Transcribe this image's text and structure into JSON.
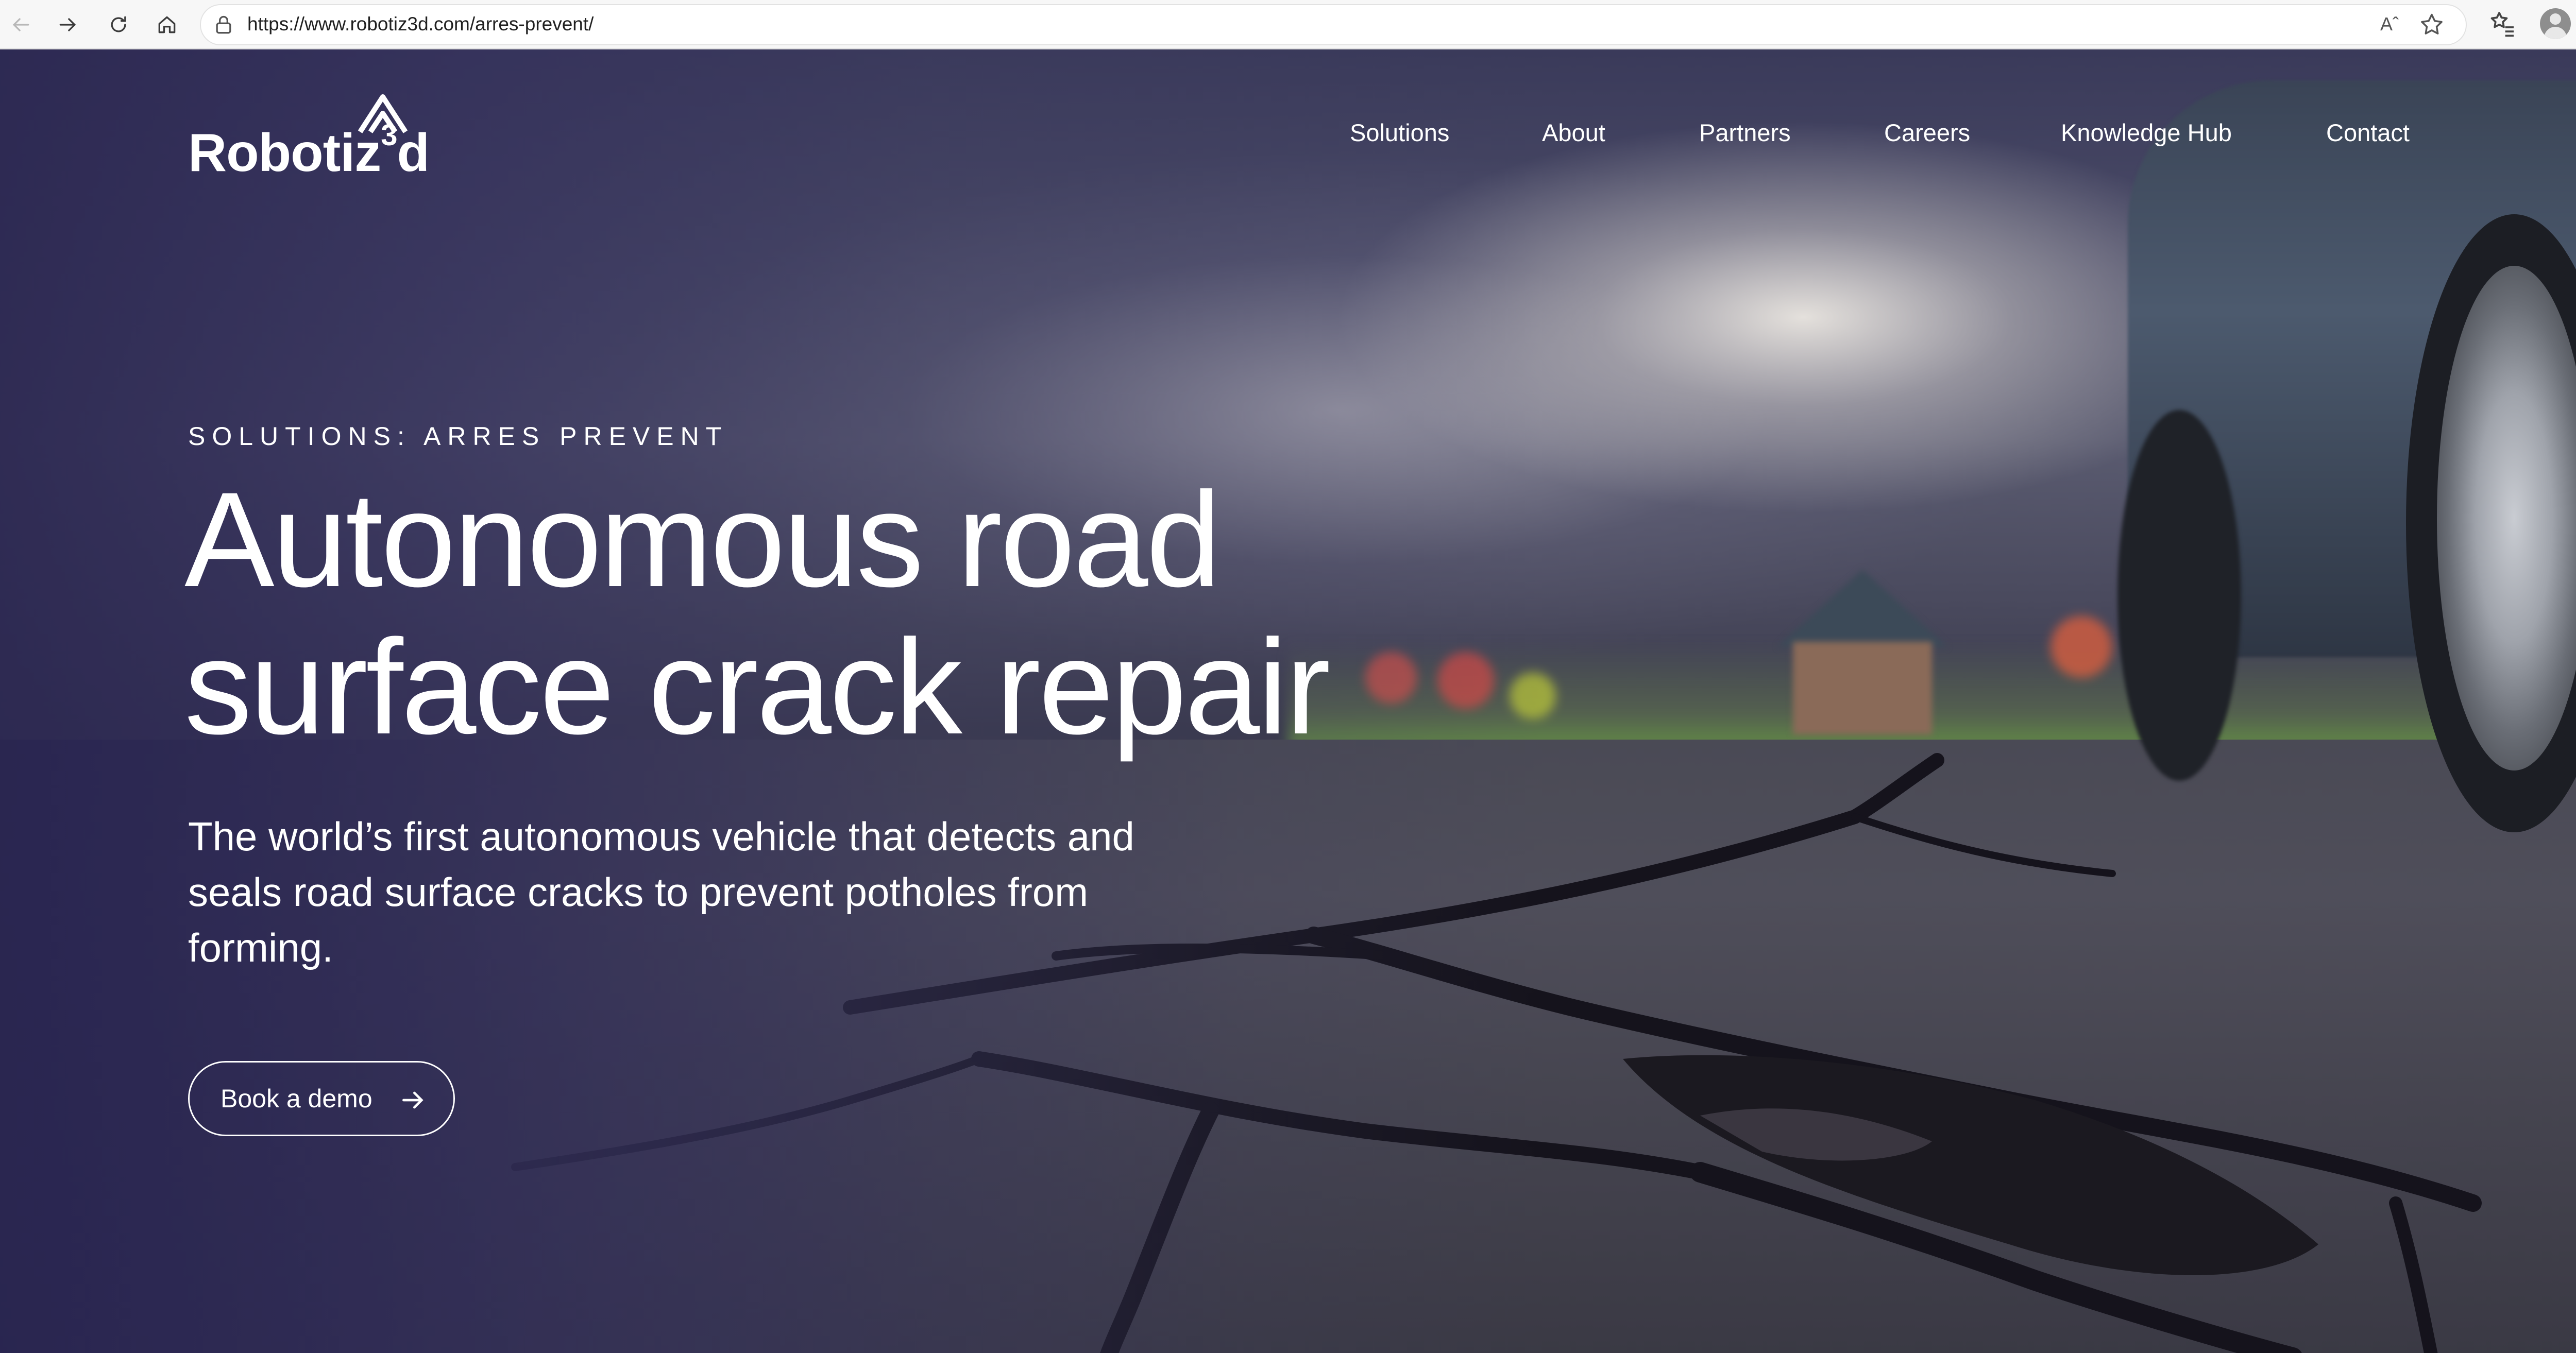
{
  "browser": {
    "url": "https://www.robotiz3d.com/arres-prevent/",
    "reader_label": "Aˆ",
    "icons": [
      "back-icon",
      "forward-icon",
      "reload-icon",
      "home-icon",
      "lock-icon",
      "read-aloud-icon",
      "star-icon",
      "favorites-icon",
      "profile-icon",
      "more-icon"
    ]
  },
  "site": {
    "logo_text": "Robotiz",
    "logo_superscript": "3",
    "logo_suffix": "d"
  },
  "nav": {
    "items": [
      {
        "label": "Solutions"
      },
      {
        "label": "About"
      },
      {
        "label": "Partners"
      },
      {
        "label": "Careers"
      },
      {
        "label": "Knowledge Hub"
      },
      {
        "label": "Contact"
      }
    ]
  },
  "hero": {
    "eyebrow": "SOLUTIONS: ARRES PREVENT",
    "headline_line1": "Autonomous road",
    "headline_line2": "surface crack repair",
    "subcopy": "The world’s first autonomous vehicle that detects and seals road surface cracks to prevent potholes from forming.",
    "cta_label": "Book a demo"
  },
  "colors": {
    "text": "#ffffff",
    "hero_tint": "#2c2852",
    "grass": "#6fae3f"
  }
}
